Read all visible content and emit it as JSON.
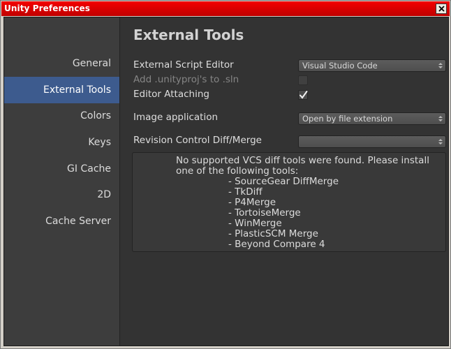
{
  "window": {
    "title": "Unity Preferences",
    "close_icon": "close-icon"
  },
  "sidebar": {
    "items": [
      {
        "label": "General",
        "selected": false
      },
      {
        "label": "External Tools",
        "selected": true
      },
      {
        "label": "Colors",
        "selected": false
      },
      {
        "label": "Keys",
        "selected": false
      },
      {
        "label": "GI Cache",
        "selected": false
      },
      {
        "label": "2D",
        "selected": false
      },
      {
        "label": "Cache Server",
        "selected": false
      }
    ],
    "selected_color": "#3d5b8e"
  },
  "main": {
    "heading": "External Tools",
    "external_script_editor": {
      "label": "External Script Editor",
      "value": "Visual Studio Code"
    },
    "add_unityproj": {
      "label": "Add .unityproj's to .sln",
      "checked": false,
      "disabled": true
    },
    "editor_attaching": {
      "label": "Editor Attaching",
      "checked": true
    },
    "image_application": {
      "label": "Image application",
      "value": "Open by file extension"
    },
    "revision_control": {
      "label": "Revision Control Diff/Merge",
      "value": ""
    },
    "help": {
      "message": "No supported VCS diff tools were found. Please install one of the following tools:",
      "tools": [
        "- SourceGear DiffMerge",
        "- TkDiff",
        "- P4Merge",
        "- TortoiseMerge",
        "- WinMerge",
        "- PlasticSCM Merge",
        "- Beyond Compare 4"
      ]
    }
  },
  "colors": {
    "title_bar": "#e00000",
    "background": "#333333",
    "sidebar": "#3d3d3d"
  }
}
